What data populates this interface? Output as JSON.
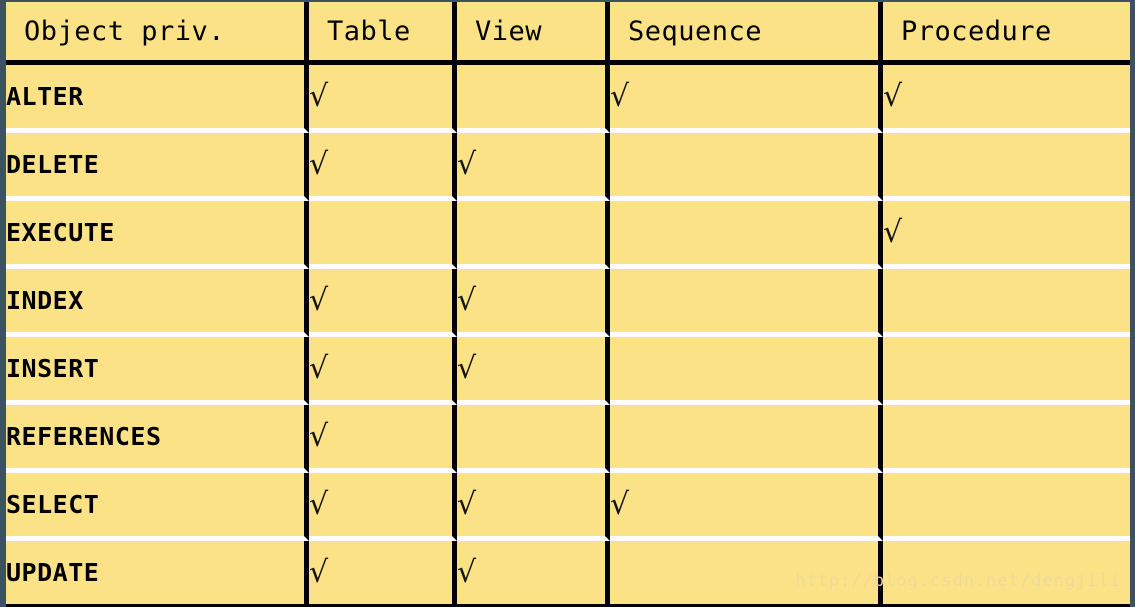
{
  "table": {
    "columns": [
      {
        "key": "priv",
        "label": "Object priv."
      },
      {
        "key": "table",
        "label": "Table"
      },
      {
        "key": "view",
        "label": "View"
      },
      {
        "key": "sequence",
        "label": "Sequence"
      },
      {
        "key": "procedure",
        "label": "Procedure"
      }
    ],
    "check_symbol": "√",
    "rows": [
      {
        "priv": "ALTER",
        "table": "√",
        "view": "",
        "sequence": "√",
        "procedure": "√"
      },
      {
        "priv": "DELETE",
        "table": "√",
        "view": "√",
        "sequence": "",
        "procedure": ""
      },
      {
        "priv": "EXECUTE",
        "table": "",
        "view": "",
        "sequence": "",
        "procedure": "√"
      },
      {
        "priv": "INDEX",
        "table": "√",
        "view": "√",
        "sequence": "",
        "procedure": ""
      },
      {
        "priv": "INSERT",
        "table": "√",
        "view": "√",
        "sequence": "",
        "procedure": ""
      },
      {
        "priv": "REFERENCES",
        "table": "√",
        "view": "",
        "sequence": "",
        "procedure": ""
      },
      {
        "priv": "SELECT",
        "table": "√",
        "view": "√",
        "sequence": "√",
        "procedure": ""
      },
      {
        "priv": "UPDATE",
        "table": "√",
        "view": "√",
        "sequence": "",
        "procedure": ""
      }
    ]
  },
  "watermark": {
    "text": "http://blog.csdn.net/dengjili"
  },
  "colors": {
    "cell_background": "#fce287",
    "frame": "#3d5160",
    "grid_vertical": "#000000",
    "grid_horizontal": "#ffffff",
    "text": "#000000",
    "watermark": "#efd898"
  }
}
